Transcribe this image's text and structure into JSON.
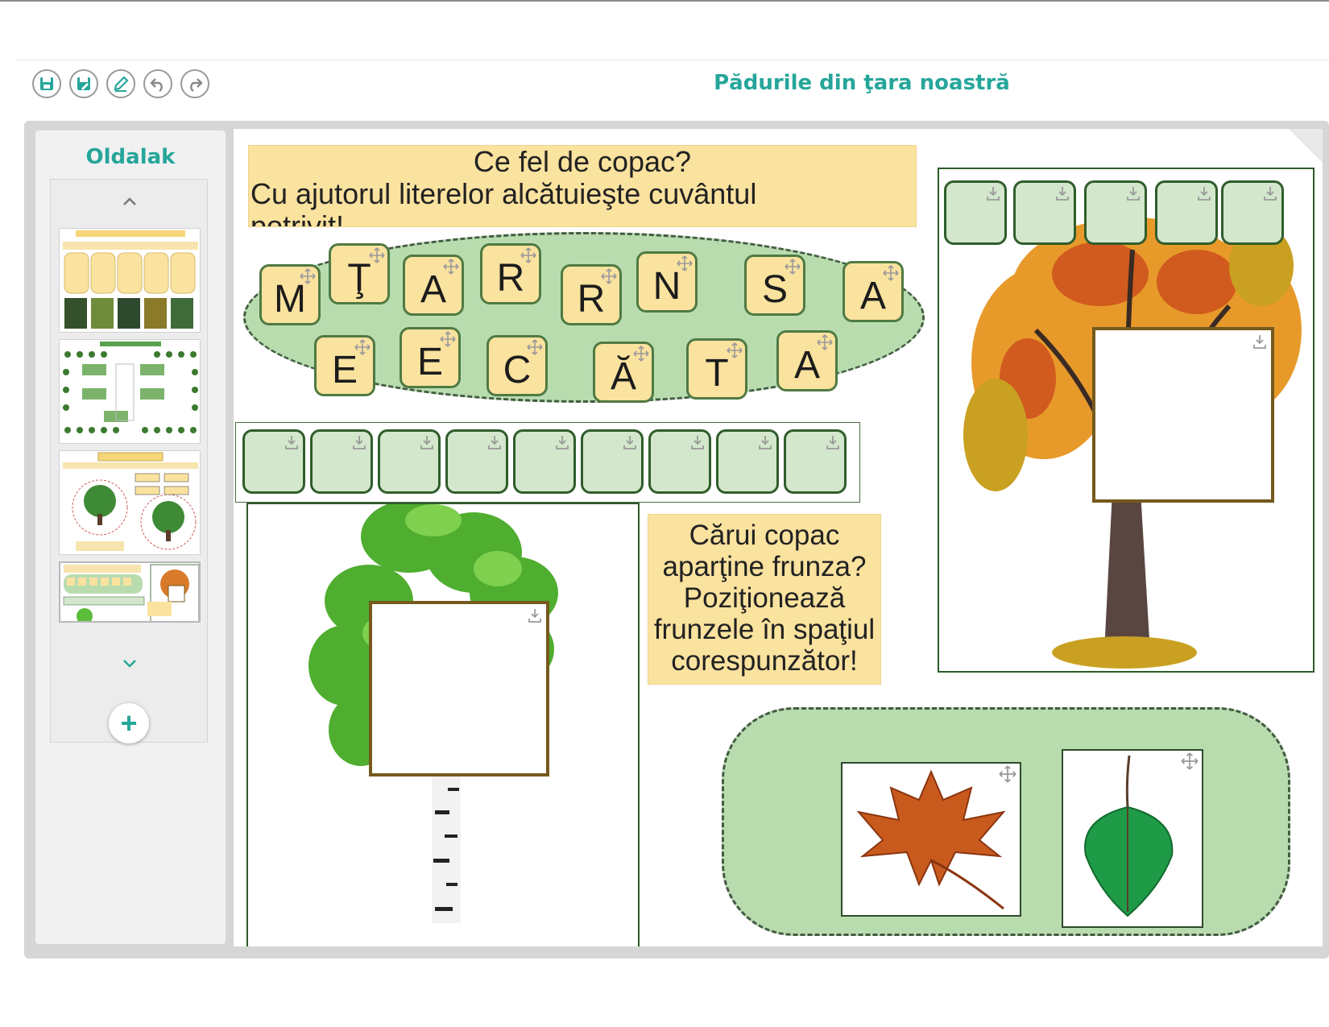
{
  "header": {
    "title": "Pădurile din ţara noastră",
    "toolbar": [
      {
        "name": "save-button",
        "icon": "floppy-icon"
      },
      {
        "name": "save-as-button",
        "icon": "floppy-edit-icon"
      },
      {
        "name": "edit-button",
        "icon": "pencil-icon"
      },
      {
        "name": "undo-button",
        "icon": "undo-icon"
      },
      {
        "name": "redo-button",
        "icon": "redo-icon"
      }
    ]
  },
  "sidebar": {
    "title": "Oldalak",
    "add_label": "+"
  },
  "canvas": {
    "instruction1": {
      "line1": "Ce fel de copac?",
      "line2": "Cu ajutorul literelor alcătuieşte cuvântul",
      "line3": "potrivit!"
    },
    "letters_row1": [
      "M",
      "Ţ",
      "A",
      "R",
      "R",
      "N",
      "S",
      "A"
    ],
    "letters_row2": [
      "E",
      "E",
      "C",
      "Ă",
      "T",
      "A"
    ],
    "instruction2": {
      "line1": "Cărui copac",
      "line2": "aparţine frunza?",
      "line3": "Poziţionează",
      "line4": "frunzele în spaţiul",
      "line5": "corespunzător!"
    },
    "leaf_cards": [
      "maple-leaf",
      "birch-leaf"
    ],
    "colors": {
      "accent": "#26a69a",
      "tile": "#fae29f",
      "slot": "#d3e7cc",
      "pool": "#b9dcaf"
    }
  }
}
